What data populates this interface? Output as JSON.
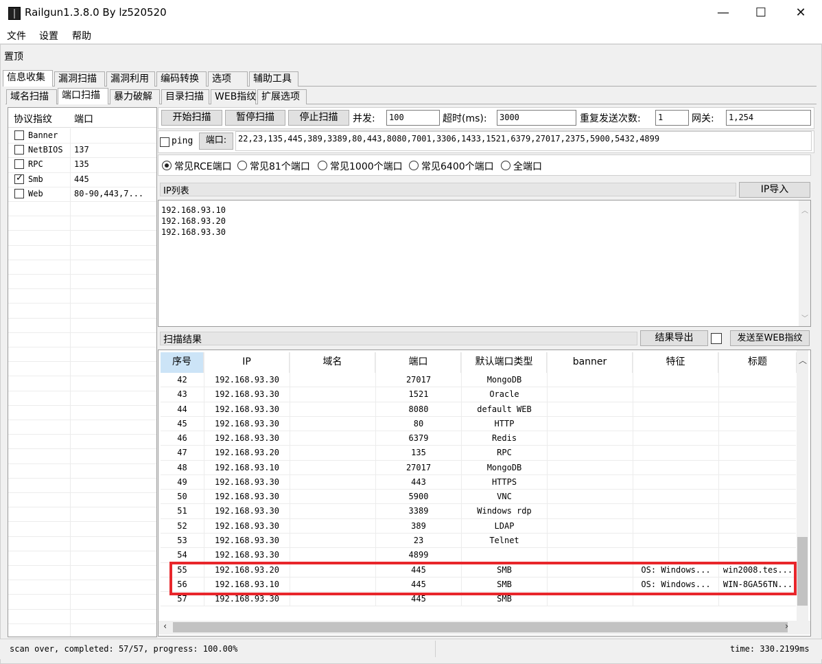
{
  "window": {
    "title": "Railgun1.3.8.0 By lz520520",
    "minimize": "—",
    "maximize": "☐",
    "close": "✕"
  },
  "menu": [
    "文件",
    "设置",
    "帮助"
  ],
  "pin_label": "置顶",
  "main_tabs": [
    "信息收集",
    "漏洞扫描",
    "漏洞利用",
    "编码转换",
    "选项",
    "辅助工具"
  ],
  "sub_tabs": [
    "域名扫描",
    "端口扫描",
    "暴力破解",
    "目录扫描",
    "WEB指纹",
    "扩展选项"
  ],
  "protocol_panel": {
    "headers": [
      "协议指纹",
      "端口"
    ],
    "rows": [
      {
        "name": "Banner",
        "ports": "",
        "checked": false
      },
      {
        "name": "NetBIOS",
        "ports": "137",
        "checked": false
      },
      {
        "name": "RPC",
        "ports": "135",
        "checked": false
      },
      {
        "name": "Smb",
        "ports": "445",
        "checked": true
      },
      {
        "name": "Web",
        "ports": "80-90,443,7...",
        "checked": false
      }
    ]
  },
  "controls": {
    "start": "开始扫描",
    "pause": "暂停扫描",
    "stop": "停止扫描",
    "concurrency_label": "并发:",
    "concurrency": "100",
    "timeout_label": "超时(ms):",
    "timeout": "3000",
    "retry_label": "重复发送次数:",
    "retry": "1",
    "gateway_label": "网关:",
    "gateway": "1,254",
    "ping_label": "ping",
    "port_label": "端口:",
    "ports": "22,23,135,445,389,3389,80,443,8080,7001,3306,1433,1521,6379,27017,2375,5900,5432,4899"
  },
  "port_presets": [
    {
      "label": "常见RCE端口",
      "selected": true
    },
    {
      "label": "常见81个端口",
      "selected": false
    },
    {
      "label": "常见1000个端口",
      "selected": false
    },
    {
      "label": "常见6400个端口",
      "selected": false
    },
    {
      "label": "全端口",
      "selected": false
    }
  ],
  "ip_list": {
    "title": "IP列表",
    "import_button": "IP导入",
    "ips": [
      "192.168.93.10",
      "192.168.93.20",
      "192.168.93.30"
    ]
  },
  "results": {
    "title": "扫描结果",
    "export_button": "结果导出",
    "send_button": "发送至WEB指纹",
    "columns": [
      "序号",
      "IP",
      "域名",
      "端口",
      "默认端口类型",
      "banner",
      "特征",
      "标题"
    ],
    "rows": [
      {
        "no": "42",
        "ip": "192.168.93.30",
        "domain": "",
        "port": "27017",
        "type": "MongoDB",
        "banner": "",
        "feature": "",
        "title": ""
      },
      {
        "no": "43",
        "ip": "192.168.93.30",
        "domain": "",
        "port": "1521",
        "type": "Oracle",
        "banner": "",
        "feature": "",
        "title": ""
      },
      {
        "no": "44",
        "ip": "192.168.93.30",
        "domain": "",
        "port": "8080",
        "type": "default WEB",
        "banner": "",
        "feature": "",
        "title": ""
      },
      {
        "no": "45",
        "ip": "192.168.93.30",
        "domain": "",
        "port": "80",
        "type": "HTTP",
        "banner": "",
        "feature": "",
        "title": ""
      },
      {
        "no": "46",
        "ip": "192.168.93.30",
        "domain": "",
        "port": "6379",
        "type": "Redis",
        "banner": "",
        "feature": "",
        "title": ""
      },
      {
        "no": "47",
        "ip": "192.168.93.20",
        "domain": "",
        "port": "135",
        "type": "RPC",
        "banner": "",
        "feature": "",
        "title": ""
      },
      {
        "no": "48",
        "ip": "192.168.93.10",
        "domain": "",
        "port": "27017",
        "type": "MongoDB",
        "banner": "",
        "feature": "",
        "title": ""
      },
      {
        "no": "49",
        "ip": "192.168.93.30",
        "domain": "",
        "port": "443",
        "type": "HTTPS",
        "banner": "",
        "feature": "",
        "title": ""
      },
      {
        "no": "50",
        "ip": "192.168.93.30",
        "domain": "",
        "port": "5900",
        "type": "VNC",
        "banner": "",
        "feature": "",
        "title": ""
      },
      {
        "no": "51",
        "ip": "192.168.93.30",
        "domain": "",
        "port": "3389",
        "type": "Windows rdp",
        "banner": "",
        "feature": "",
        "title": ""
      },
      {
        "no": "52",
        "ip": "192.168.93.30",
        "domain": "",
        "port": "389",
        "type": "LDAP",
        "banner": "",
        "feature": "",
        "title": ""
      },
      {
        "no": "53",
        "ip": "192.168.93.30",
        "domain": "",
        "port": "23",
        "type": "Telnet",
        "banner": "",
        "feature": "",
        "title": ""
      },
      {
        "no": "54",
        "ip": "192.168.93.30",
        "domain": "",
        "port": "4899",
        "type": "",
        "banner": "",
        "feature": "",
        "title": ""
      },
      {
        "no": "55",
        "ip": "192.168.93.20",
        "domain": "",
        "port": "445",
        "type": "SMB",
        "banner": "",
        "feature": "OS: Windows...",
        "title": "win2008.tes..."
      },
      {
        "no": "56",
        "ip": "192.168.93.10",
        "domain": "",
        "port": "445",
        "type": "SMB",
        "banner": "",
        "feature": "OS: Windows...",
        "title": "WIN-8GA56TN..."
      },
      {
        "no": "57",
        "ip": "192.168.93.30",
        "domain": "",
        "port": "445",
        "type": "SMB",
        "banner": "",
        "feature": "",
        "title": ""
      }
    ],
    "highlight_color": "#e8262b"
  },
  "status": {
    "left": "scan over, completed: 57/57, progress: 100.00%",
    "right": "time: 330.2199ms"
  }
}
